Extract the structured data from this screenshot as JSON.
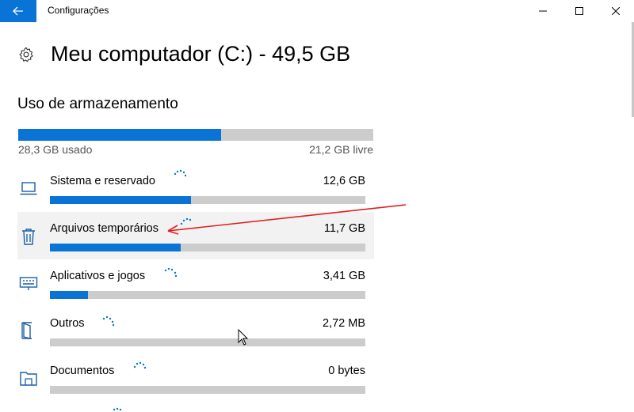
{
  "window": {
    "title": "Configurações",
    "back_icon": "arrow-left-icon",
    "controls": [
      "minimize-icon",
      "maximize-icon",
      "close-icon"
    ]
  },
  "header": {
    "icon": "gear-icon",
    "title": "Meu computador (C:) - 49,5 GB"
  },
  "storage": {
    "section_title": "Uso de armazenamento",
    "used_fraction": 0.572,
    "used_label": "28,3 GB usado",
    "free_label": "21,2 GB livre",
    "accent_color": "#0a74d6",
    "track_color": "#cccccc"
  },
  "categories": [
    {
      "name": "Sistema e reservado",
      "size": "12,6 GB",
      "fraction": 0.447,
      "icon": "laptop-icon"
    },
    {
      "name": "Arquivos temporários",
      "size": "11,7 GB",
      "fraction": 0.415,
      "icon": "trash-icon"
    },
    {
      "name": "Aplicativos e jogos",
      "size": "3,41 GB",
      "fraction": 0.12,
      "icon": "keyboard-icon"
    },
    {
      "name": "Outros",
      "size": "2,72 MB",
      "fraction": 0.0,
      "icon": "door-icon"
    },
    {
      "name": "Documentos",
      "size": "0 bytes",
      "fraction": 0.0,
      "icon": "folder-icon"
    }
  ],
  "annotation": {
    "color": "#e02020",
    "icon": "red-arrow-annotation"
  }
}
